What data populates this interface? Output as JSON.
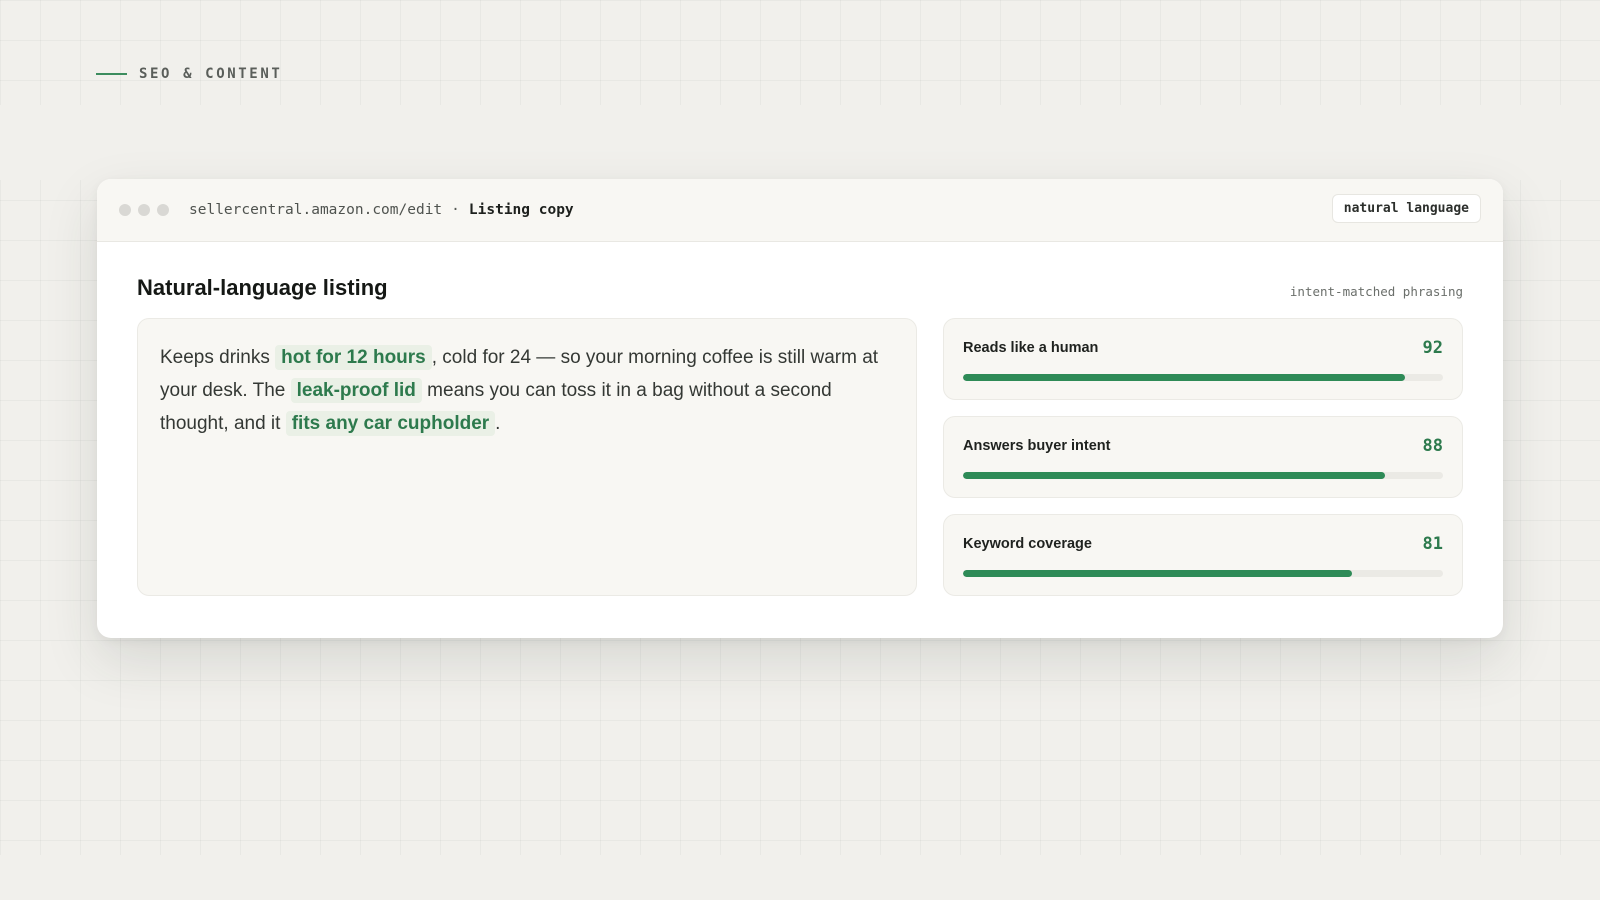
{
  "eyebrow": {
    "text": "SEO & CONTENT"
  },
  "window": {
    "url": "sellercentral.amazon.com/edit",
    "separator": "·",
    "page": "Listing copy",
    "badge": "natural language"
  },
  "main": {
    "title": "Natural-language listing",
    "subtitle": "intent-matched phrasing",
    "copy": {
      "t1": "Keeps drinks ",
      "h1": "hot for 12 hours",
      "t2": ", cold for 24 — so your morning coffee is still warm at your desk. The ",
      "h2": "leak-proof lid",
      "t3": " means you can toss it in a bag without a second thought, and it ",
      "h3": "fits any car cupholder",
      "t4": "."
    }
  },
  "metrics": [
    {
      "label": "Reads like a human",
      "value": 92
    },
    {
      "label": "Answers buyer intent",
      "value": 88
    },
    {
      "label": "Keyword coverage",
      "value": 81
    }
  ],
  "colors": {
    "accent": "#2e8b57",
    "highlight_bg": "#eaf0e6",
    "background": "#f1f0ec"
  }
}
